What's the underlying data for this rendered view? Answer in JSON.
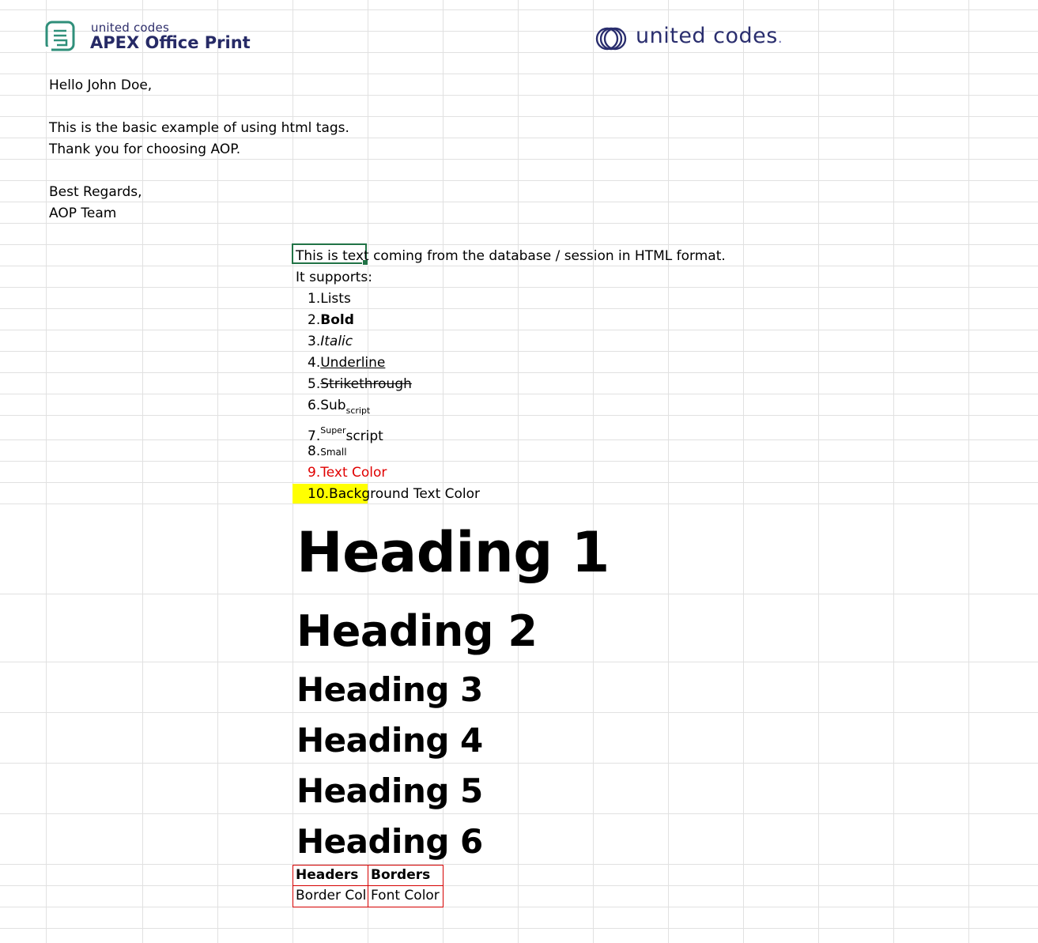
{
  "logos": {
    "aop": {
      "small_text": "united codes",
      "big_text": "APEX Office Print"
    },
    "uc": {
      "text": "united codes"
    }
  },
  "letter": {
    "greeting": "Hello John Doe,",
    "line1": "This is the basic example of using html tags.",
    "line2": "Thank you for choosing AOP.",
    "closing": "Best Regards,",
    "signature": "AOP Team"
  },
  "html_block": {
    "intro": "This is text coming from the database / session in HTML format.",
    "supports": "It supports:",
    "items": {
      "lists": {
        "num": "1.",
        "text": "Lists"
      },
      "bold": {
        "num": "2.",
        "text": "Bold"
      },
      "italic": {
        "num": "3.",
        "text": "Italic"
      },
      "underline": {
        "num": "4.",
        "text": "Underline"
      },
      "strike": {
        "num": "5.",
        "text": "Strikethrough"
      },
      "subscript": {
        "num": "6.",
        "base": "Sub",
        "sub": "script"
      },
      "superscript": {
        "num": "7.",
        "sup": "Super",
        "base": "script"
      },
      "small": {
        "num": "8.",
        "text": "Small"
      },
      "text_color": {
        "num": "9.",
        "text": "Text Color",
        "color": "#e00000"
      },
      "background": {
        "num": "10.",
        "text": "Background Text Color",
        "highlight": "#ffff00"
      }
    }
  },
  "headings": [
    "Heading 1",
    "Heading 2",
    "Heading 3",
    "Heading 4",
    "Heading 5",
    "Heading 6"
  ],
  "table": {
    "headers": [
      "Headers",
      "Borders"
    ],
    "row": [
      "Border Col",
      "Font Color"
    ],
    "border_color": "#d50000"
  },
  "colors": {
    "gridline": "#e1e1e1",
    "selection": "#217346",
    "brand": "#262a66"
  }
}
